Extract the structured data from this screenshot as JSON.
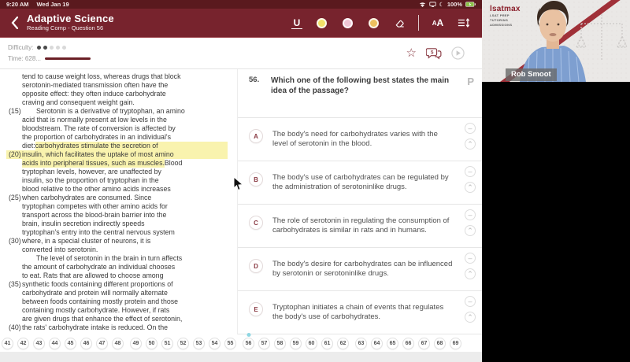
{
  "status_bar": {
    "time": "9:20 AM",
    "date": "Wed Jan 19",
    "battery": "100%"
  },
  "header": {
    "title": "Adaptive Science",
    "subtitle": "Reading Comp - Question 56",
    "tools": {
      "underline_label": "U",
      "highlighter_colors": [
        "#f2e268",
        "#efc6d5",
        "#edc05e"
      ],
      "font_small": "A",
      "font_large": "A"
    }
  },
  "meta": {
    "difficulty_label": "Difficulty:",
    "difficulty_filled": 2,
    "difficulty_total": 5,
    "time_label": "Time: 628...",
    "chat_badge": "5"
  },
  "passage": {
    "lines": [
      {
        "s": [
          [
            "tend to cause weight loss, whereas drugs that block",
            0
          ]
        ]
      },
      {
        "s": [
          [
            "serotonin-mediated transmission often have the",
            0
          ]
        ]
      },
      {
        "s": [
          [
            "opposite effect: they often induce carbohydrate",
            0
          ]
        ]
      },
      {
        "s": [
          [
            "craving and consequent weight gain.",
            0
          ]
        ]
      },
      {
        "n": "(15)",
        "p": 1,
        "s": [
          [
            "Serotonin is a derivative of tryptophan, an amino",
            0
          ]
        ]
      },
      {
        "s": [
          [
            "acid that is normally present at low levels in the",
            0
          ]
        ]
      },
      {
        "s": [
          [
            "bloodstream. The rate of conversion is affected by",
            0
          ]
        ]
      },
      {
        "s": [
          [
            "the proportion of carbohydrates in an individual's",
            0
          ]
        ]
      },
      {
        "s": [
          [
            "diet: ",
            0
          ],
          [
            "carbohydrates stimulate the secretion of",
            1
          ]
        ],
        "x": 1
      },
      {
        "n": "(20)",
        "nh": 1,
        "s": [
          [
            "insulin, which facilitates the uptake of most amino",
            1
          ]
        ],
        "x": 1
      },
      {
        "s": [
          [
            "acids into peripheral tissues, such as muscles.",
            1
          ],
          [
            " Blood",
            0
          ]
        ]
      },
      {
        "s": [
          [
            "tryptophan levels, however, are unaffected by",
            0
          ]
        ]
      },
      {
        "s": [
          [
            "insulin, so the proportion of tryptophan in the",
            0
          ]
        ]
      },
      {
        "s": [
          [
            "blood relative to the other amino acids increases",
            0
          ]
        ]
      },
      {
        "n": "(25)",
        "s": [
          [
            "when carbohydrates are consumed. Since",
            0
          ]
        ]
      },
      {
        "s": [
          [
            "tryptophan competes with other amino acids for",
            0
          ]
        ]
      },
      {
        "s": [
          [
            "transport across the blood-brain barrier into the",
            0
          ]
        ]
      },
      {
        "s": [
          [
            "brain, insulin secretion indirectly speeds",
            0
          ]
        ]
      },
      {
        "s": [
          [
            "tryptophan's entry into the central nervous system",
            0
          ]
        ]
      },
      {
        "n": "(30)",
        "s": [
          [
            "where, in a special cluster of neurons, it is",
            0
          ]
        ]
      },
      {
        "s": [
          [
            "converted into serotonin.",
            0
          ]
        ]
      },
      {
        "p": 1,
        "s": [
          [
            "The level of serotonin in the brain in turn affects",
            0
          ]
        ]
      },
      {
        "s": [
          [
            "the amount of carbohydrate an individual chooses",
            0
          ]
        ]
      },
      {
        "s": [
          [
            "to eat. Rats that are allowed to choose among",
            0
          ]
        ]
      },
      {
        "n": "(35)",
        "s": [
          [
            "synthetic foods containing different proportions of",
            0
          ]
        ]
      },
      {
        "s": [
          [
            "carbohydrate and protein will normally alternate",
            0
          ]
        ]
      },
      {
        "s": [
          [
            "between foods containing mostly protein and those",
            0
          ]
        ]
      },
      {
        "s": [
          [
            "containing mostly carbohydrate. However, if rats",
            0
          ]
        ]
      },
      {
        "s": [
          [
            "are given drugs that enhance the effect of serotonin,",
            0
          ]
        ]
      },
      {
        "n": "(40)",
        "s": [
          [
            "the rats' carbohydrate intake is reduced. On the",
            0
          ]
        ]
      }
    ]
  },
  "question": {
    "number": "56.",
    "text": "Which one of the following best states the main idea of the passage?",
    "flag_label": "P"
  },
  "answers": [
    {
      "letter": "A",
      "text": "The body's need for carbohydrates varies with the level of serotonin in the blood."
    },
    {
      "letter": "B",
      "text": "The body's use of carbohydrates can be regulated by the administration of serotoninlike drugs."
    },
    {
      "letter": "C",
      "text": "The role of serotonin in regulating the consumption of carbohydrates is similar in rats and in humans."
    },
    {
      "letter": "D",
      "text": "The body's desire for carbohydrates can be influenced by serotonin or serotoninlike drugs."
    },
    {
      "letter": "E",
      "text": "Tryptophan initiates a chain of events that regulates the body's use of carbohydrates."
    }
  ],
  "nav": {
    "groups": [
      [
        41,
        42,
        43,
        44,
        45,
        46,
        47,
        48
      ],
      [
        49,
        50,
        51,
        52,
        53,
        54,
        55
      ],
      [
        56,
        57,
        58,
        59,
        60,
        61,
        62
      ],
      [
        63,
        64,
        65,
        66,
        67,
        68,
        69
      ]
    ],
    "current": 56
  },
  "video": {
    "participant_name": "Rob Smoot",
    "brand": "lsatmax",
    "brand_sub": [
      "LSAT PREP",
      "TUTORING",
      "ADMISSIONS"
    ]
  },
  "colors": {
    "status_bar_bg": "#5a191e",
    "header_bg": "#77232d",
    "accent_maroon": "#8a3b44",
    "highlight_yellow": "#f9f3ae",
    "progress_bar": "#6b1f26",
    "current_question_dot": "#8fd6e2",
    "video_stripe": "#a03038",
    "battery_green": "#8bc34a"
  }
}
